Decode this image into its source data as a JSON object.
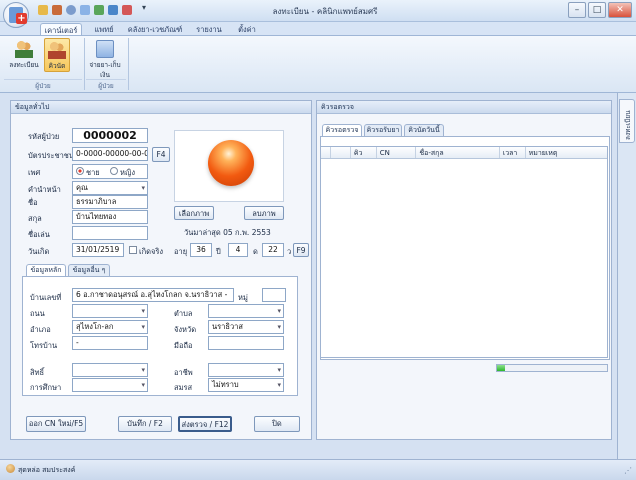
{
  "window": {
    "title": "ลงทะเบียน - คลินิกแพทย์สมศรี",
    "buttons": {
      "minimize": "–",
      "maximize": "□",
      "close": "✕"
    }
  },
  "ribbon": {
    "tabs": [
      "เคาน์เตอร์",
      "แพทย์",
      "คลังยา-เวชภัณฑ์",
      "รายงาน",
      "ตั้งค่า"
    ],
    "buttons": [
      {
        "label": "ลงทะเบียน",
        "icon": "people-icon"
      },
      {
        "label": "คิวนัด",
        "icon": "people-icon"
      },
      {
        "label": "จ่ายยา-เก็บเงิน",
        "icon": "payment-icon"
      }
    ],
    "groups": [
      "ผู้ป่วย",
      "ผู้ป่วย"
    ]
  },
  "general": {
    "header": "ข้อมูลทั่วไป",
    "patient_id_label": "รหัสผู้ป่วย",
    "patient_id": "0000002",
    "citizen_id_label": "บัตรประชาชน",
    "citizen_id": "0-0000-00000-00-0",
    "f4": "F4",
    "sex_label": "เพศ",
    "male": "ชาย",
    "female": "หญิง",
    "prefix_label": "คำนำหน้า",
    "prefix": "คุณ",
    "name_label": "ชื่อ",
    "name": "ธรรมาภิบาล",
    "surname_label": "สกุล",
    "surname": "บ้านไทยทอง",
    "nickname_label": "ชื่อเล่น",
    "nickname": "",
    "select_image": "เลือกภาพ",
    "delete_image": "ลบภาพ",
    "last_visit": "วันมาล่าสุด  05 ก.พ. 2553",
    "birthdate_label": "วันเกิด",
    "birthdate": "31/01/2519",
    "real_birth": "เกิดจริง",
    "age_label": "อายุ",
    "age_years": "36",
    "years_unit": "ปี",
    "age_months": "4",
    "months_unit": "ด",
    "age_days": "22",
    "days_unit": "ว",
    "f9": "F9"
  },
  "subtabs": [
    "ข้อมูลหลัก",
    "ข้อมูลอื่น ๆ"
  ],
  "address": {
    "house_label": "บ้านเลขที่",
    "house": "6 อ.กาชาดอนุสรณ์ อ.สุไหงโกลก จ.นราธิวาส -",
    "moo_label": "หมู่",
    "moo": "",
    "road_label": "ถนน",
    "road": "",
    "subdistrict_label": "ตำบล",
    "subdistrict": "",
    "district_label": "อำเภอ",
    "district": "สุไหงโก-ลก",
    "province_label": "จังหวัด",
    "province": "นราธิวาส",
    "phone_label": "โทรบ้าน",
    "phone": "-",
    "mobile_label": "มือถือ",
    "mobile": "",
    "rights_label": "สิทธิ์",
    "rights": "",
    "occupation_label": "อาชีพ",
    "occupation": "",
    "education_label": "การศึกษา",
    "education": "",
    "marital_label": "สมรส",
    "marital": "ไม่ทราบ"
  },
  "actions": {
    "new_cn": "ออก CN ใหม่/F5",
    "save": "บันทึก / F2",
    "send_exam": "ส่งตรวจ / F12",
    "close": "ปิด"
  },
  "queue": {
    "header": "คิวรอตรวจ",
    "tabs": [
      "คิวรอตรวจ",
      "คิวรอรับยา",
      "คิวนัดวันนี้"
    ],
    "columns": [
      "",
      "คิว",
      "CN",
      "ชื่อ-สกุล",
      "เวลา",
      "หมายเหตุ"
    ],
    "progress": 0.07
  },
  "side_tab": "ลงทะเบียน",
  "status": {
    "text": "สุดหล่อ สมประสงค์"
  },
  "colors": {
    "accent": "#2f6fcf",
    "progress": "#2db82d",
    "orb": "#f25a10"
  }
}
